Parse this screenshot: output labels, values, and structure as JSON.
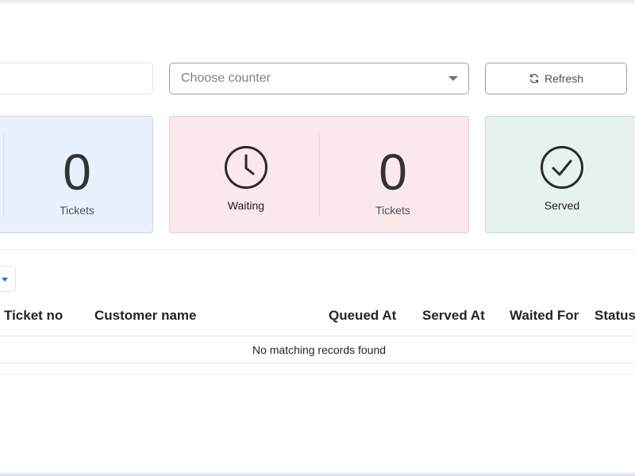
{
  "filters": {
    "search_value": "",
    "counter_placeholder": "Choose counter",
    "refresh_label": "Refresh"
  },
  "cards": {
    "first": {
      "count": "0",
      "count_label": "Tickets",
      "color": "#e8f1fd"
    },
    "waiting": {
      "label": "Waiting",
      "count": "0",
      "count_label": "Tickets",
      "color": "#fbe8ea"
    },
    "served": {
      "label": "Served",
      "color": "#e6f2ec"
    }
  },
  "table": {
    "headers": [
      "Ticket no",
      "Customer name",
      "Queued At",
      "Served At",
      "Waited For",
      "Status"
    ],
    "empty_message": "No matching records found"
  },
  "icons": {
    "refresh": "refresh-icon",
    "waiting": "clock-icon",
    "served": "check-circle-icon",
    "dropdown": "chevron-down-icon"
  },
  "colors": {
    "accent": "#0d6efd"
  }
}
